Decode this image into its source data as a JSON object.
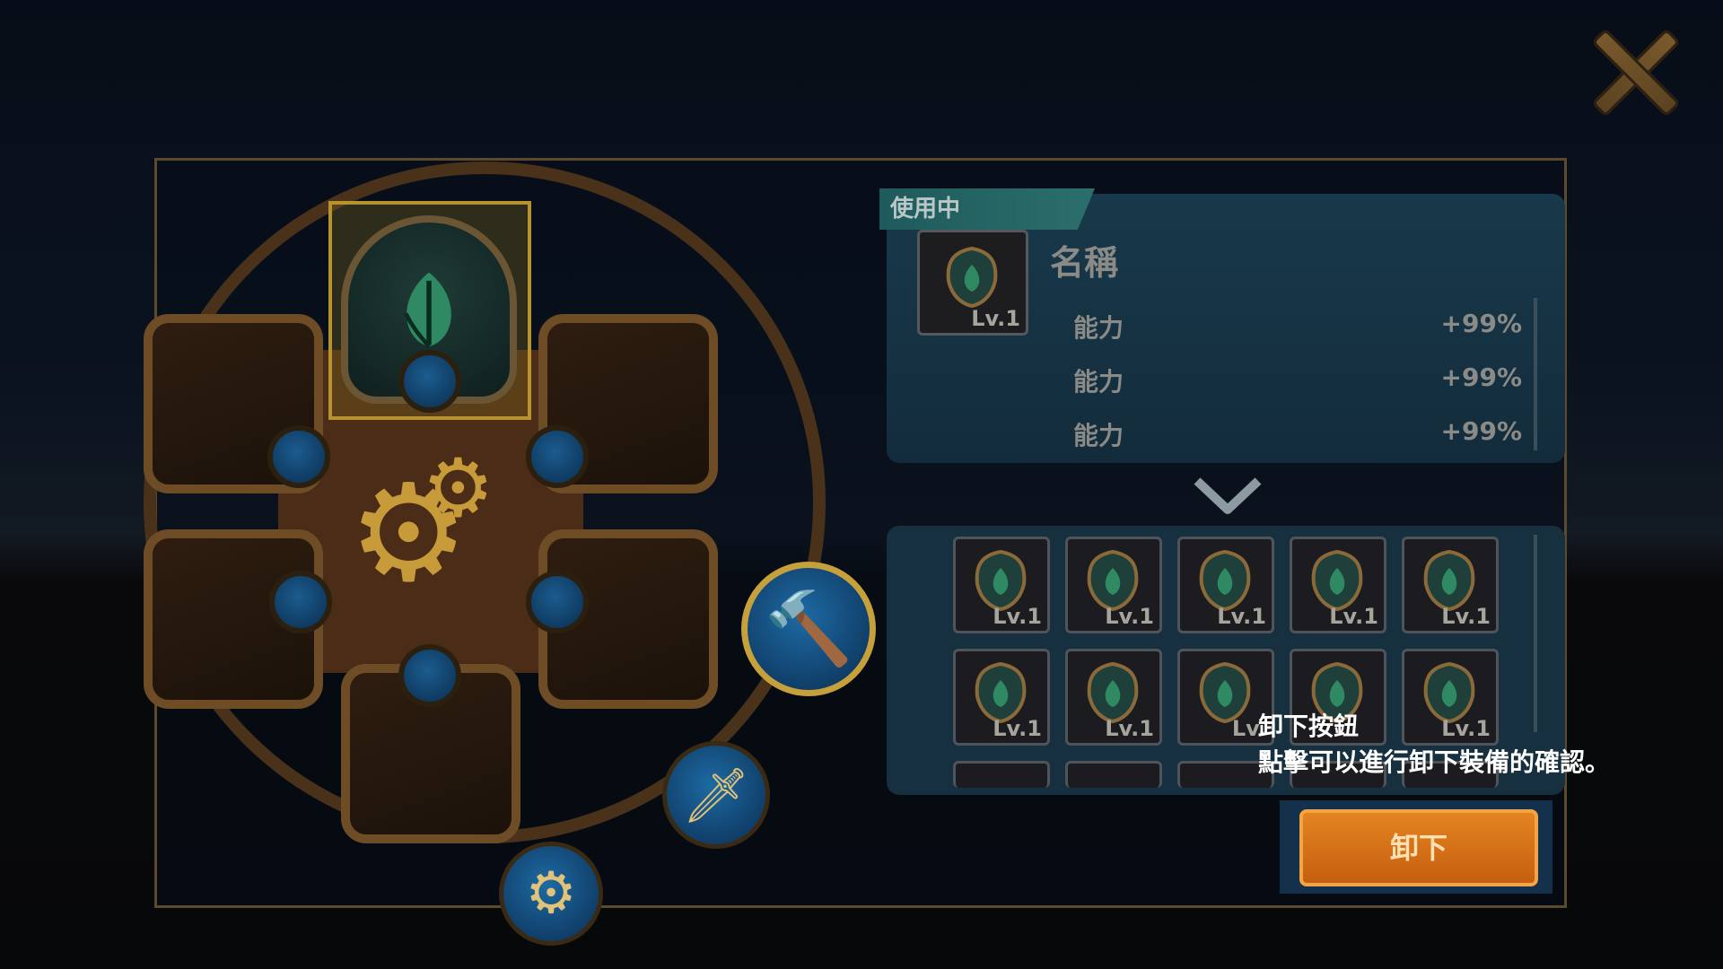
{
  "panel": {
    "in_use_tag": "使用中",
    "item_name": "名稱",
    "item_level": "Lv.1",
    "stats": [
      {
        "label": "能力",
        "value": "+99%"
      },
      {
        "label": "能力",
        "value": "+99%"
      },
      {
        "label": "能力",
        "value": "+99%"
      }
    ]
  },
  "inventory": {
    "rows": [
      [
        "Lv.1",
        "Lv.1",
        "Lv.1",
        "Lv.1",
        "Lv.1"
      ],
      [
        "Lv.1",
        "Lv.1",
        "Lv.",
        "",
        "Lv.1"
      ]
    ]
  },
  "tooltip": {
    "title": "卸下按鈕",
    "description": "點擊可以進行卸下裝備的確認。"
  },
  "buttons": {
    "unequip": "卸下"
  },
  "icons": {
    "close": "close-x-icon",
    "leaf": "leaf-icon",
    "gears": "gears-icon",
    "hammer": "hammer-icon",
    "sword": "sword-icon",
    "chevron": "chevron-down-icon"
  },
  "colors": {
    "accent_gold": "#b8922e",
    "button_orange": "#e48421",
    "tag_teal": "#2b6f6c"
  }
}
